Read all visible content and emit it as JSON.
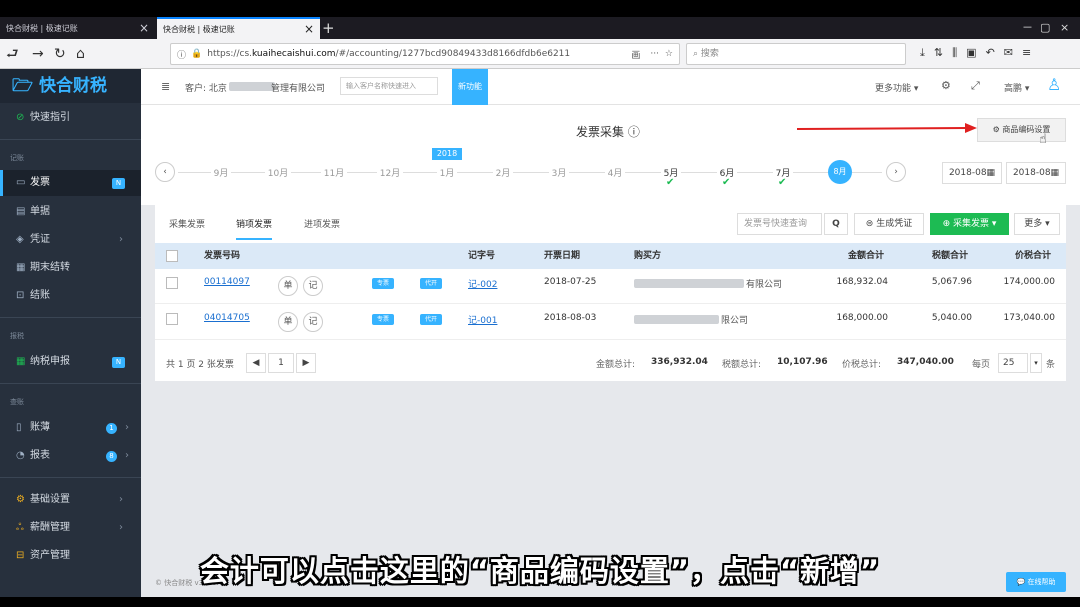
{
  "browser": {
    "tabs": [
      {
        "label": "快合财税 | 极速记账",
        "close": "×"
      },
      {
        "label": "快合财税 | 极速记账",
        "close": "×"
      }
    ],
    "new_tab": "+",
    "window_controls": [
      "－",
      "▢",
      "×"
    ],
    "url_prefix": "https://cs.",
    "url_domain": "kuaihecaishui.com",
    "url_rest": "/#/accounting/1277bcd90849433d8166dfdb6e6211",
    "reader_icon": "画",
    "more_icon": "···",
    "search_placeholder": "搜索",
    "toolbar_icons": [
      "⤓",
      "⇅",
      "⫼",
      "▣",
      "↶",
      "✉",
      "≡"
    ]
  },
  "sidebar": {
    "logo": "快合财税",
    "quick_guide": "快速指引",
    "group_record": "记账",
    "items": [
      {
        "label": "发票",
        "badge": "N"
      },
      {
        "label": "单据"
      },
      {
        "label": "凭证"
      },
      {
        "label": "期末结转"
      },
      {
        "label": "结账"
      }
    ],
    "group_tax": "报税",
    "tax_item": {
      "label": "纳税申报",
      "badge": "N"
    },
    "group_query": "查账",
    "query_items": [
      {
        "label": "账薄",
        "badge": "1"
      },
      {
        "label": "报表",
        "badge": "8"
      }
    ],
    "settings_items": [
      {
        "label": "基础设置"
      },
      {
        "label": "薪酬管理"
      },
      {
        "label": "资产管理"
      }
    ],
    "version": "© 快合财税 v3.7.0.7"
  },
  "topbar": {
    "client_label": "客户: 北京",
    "client_suffix": "管理有限公司",
    "client_search_placeholder": "输入客户名称快速进入",
    "new_feature": "新功能",
    "more_features": "更多功能 ▾",
    "user": "高鹏 ▾"
  },
  "page": {
    "title": "发票采集 ⓘ",
    "goods_code_btn": "⚙ 商品编码设置",
    "year_badge": "2018",
    "months": [
      "9月",
      "10月",
      "11月",
      "12月",
      "1月",
      "2月",
      "3月",
      "4月",
      "5月",
      "6月",
      "7月"
    ],
    "current_month": "8月",
    "date_from": "2018-08",
    "date_to": "2018-08"
  },
  "tabs": [
    "采集发票",
    "销项发票",
    "进项发票"
  ],
  "actions": {
    "search_placeholder": "发票号快速查询",
    "search_icon": "Q",
    "gen_voucher": "⊜ 生成凭证",
    "collect": "⊕ 采集发票 ▾",
    "more": "更多 ▾"
  },
  "table": {
    "headers": {
      "no": "发票号码",
      "voucher": "记字号",
      "date": "开票日期",
      "buyer": "购买方",
      "amount": "金额合计",
      "tax": "税额合计",
      "total": "价税合计"
    },
    "rows": [
      {
        "no": "00114097",
        "dan": "单",
        "ji": "记",
        "tag1": "专票",
        "tag2": "代开",
        "voucher": "记-002",
        "date": "2018-07-25",
        "buyer_suffix": "有限公司",
        "amount": "168,932.04",
        "tax": "5,067.96",
        "total": "174,000.00"
      },
      {
        "no": "04014705",
        "dan": "单",
        "ji": "记",
        "tag1": "专票",
        "tag2": "代开",
        "voucher": "记-001",
        "date": "2018-08-03",
        "buyer_suffix": "限公司",
        "amount": "168,000.00",
        "tax": "5,040.00",
        "total": "173,040.00"
      }
    ]
  },
  "footer": {
    "summary": "共 1 页 2 张发票",
    "page": "1",
    "amount_label": "金额总计:",
    "amount_total": "336,932.04",
    "tax_label": "税额总计:",
    "tax_total": "10,107.96",
    "total_label": "价税总计:",
    "grand_total": "347,040.00",
    "per_page_label": "每页",
    "per_page": "25",
    "per_page_unit": "条"
  },
  "help": "💬 在线帮助",
  "subtitle": "会计可以点击这里的“商品编码设置”，点击“新增”",
  "colors": {
    "accent": "#36b3ff",
    "green": "#1dbb53",
    "sidebar": "#27303d",
    "arrow": "#e02020"
  }
}
